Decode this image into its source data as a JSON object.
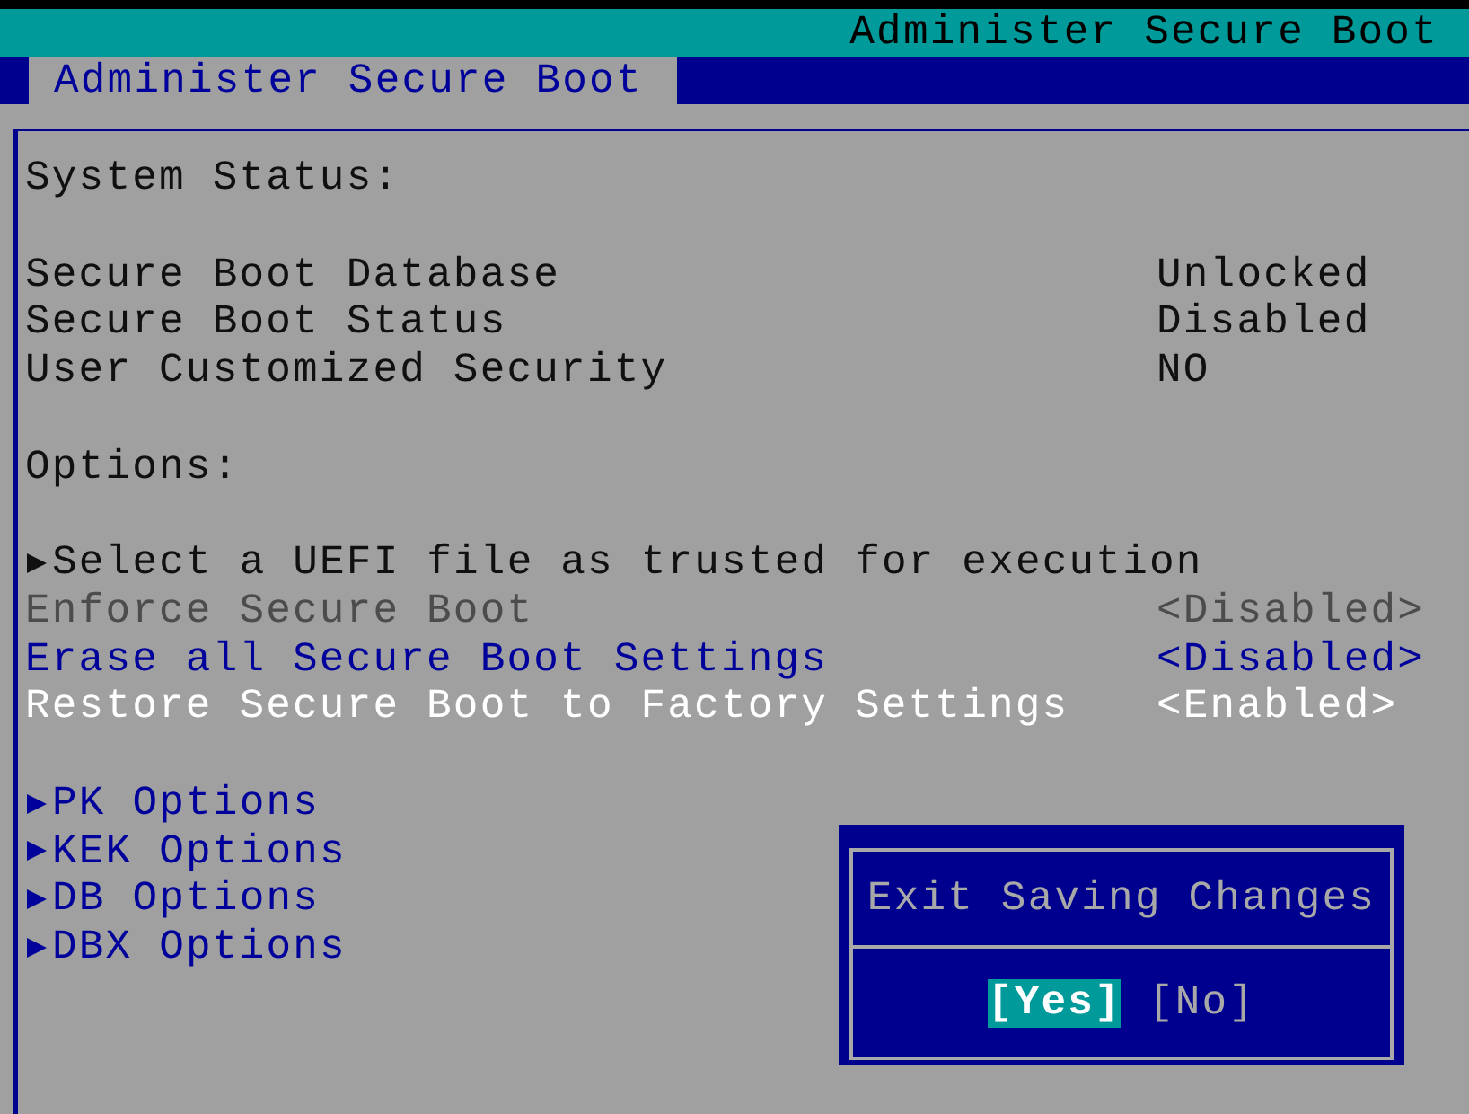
{
  "header": {
    "title": "Administer Secure Boot"
  },
  "tabs": [
    {
      "label": "Administer Secure Boot",
      "selected": true
    }
  ],
  "system_status": {
    "heading": "System Status:",
    "items": [
      {
        "label": "Secure Boot Database",
        "value": "Unlocked"
      },
      {
        "label": "Secure Boot Status",
        "value": "Disabled"
      },
      {
        "label": "User Customized Security",
        "value": "NO"
      }
    ]
  },
  "options": {
    "heading": "Options:",
    "groups": [
      {
        "items": [
          {
            "kind": "submenu",
            "label": "Select a UEFI file as trusted for execution",
            "selected": false,
            "disabled": false,
            "editable": false
          },
          {
            "kind": "setting",
            "label": "Enforce Secure Boot",
            "value": "<Disabled>",
            "selected": false,
            "disabled": true,
            "editable": false
          },
          {
            "kind": "setting",
            "label": "Erase all Secure Boot Settings",
            "value": "<Disabled>",
            "selected": false,
            "disabled": false,
            "editable": true
          },
          {
            "kind": "setting",
            "label": "Restore Secure Boot to Factory Settings",
            "value": "<Enabled>",
            "selected": true,
            "disabled": false,
            "editable": true
          }
        ]
      },
      {
        "items": [
          {
            "kind": "submenu",
            "label": "PK Options",
            "selected": false,
            "disabled": false,
            "editable": true
          },
          {
            "kind": "submenu",
            "label": "KEK Options",
            "selected": false,
            "disabled": false,
            "editable": true
          },
          {
            "kind": "submenu",
            "label": "DB Options",
            "selected": false,
            "disabled": false,
            "editable": true
          },
          {
            "kind": "submenu",
            "label": "DBX Options",
            "selected": false,
            "disabled": false,
            "editable": true
          }
        ]
      }
    ]
  },
  "dialog": {
    "title": "Exit Saving Changes",
    "buttons": [
      {
        "label": "[Yes]",
        "selected": true
      },
      {
        "label": "[No]",
        "selected": false
      }
    ]
  }
}
